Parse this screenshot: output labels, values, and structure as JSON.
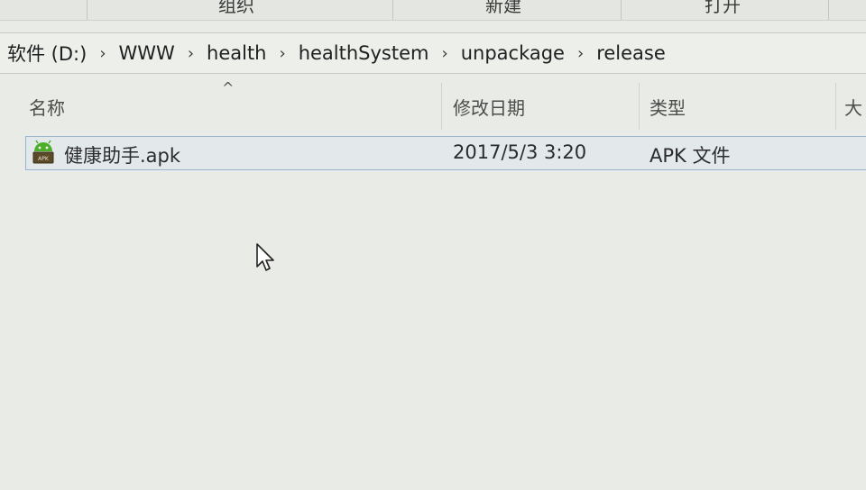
{
  "ribbon": {
    "groups": [
      {
        "label": "组织"
      },
      {
        "label": "新建"
      },
      {
        "label": "打开"
      }
    ]
  },
  "address_bar": {
    "crumbs": [
      "软件 (D:)",
      "WWW",
      "health",
      "healthSystem",
      "unpackage",
      "release"
    ],
    "separator": "›"
  },
  "columns": {
    "name": "名称",
    "modified": "修改日期",
    "type": "类型",
    "size": "大"
  },
  "files": [
    {
      "name": "健康助手.apk",
      "modified": "2017/5/3 3:20",
      "type": "APK 文件",
      "icon": "android-apk-icon",
      "selected": true
    }
  ],
  "colors": {
    "selection_border": "#9ab3cf",
    "background": "#e9ebe6",
    "apk_icon_green": "#4caf2a"
  }
}
